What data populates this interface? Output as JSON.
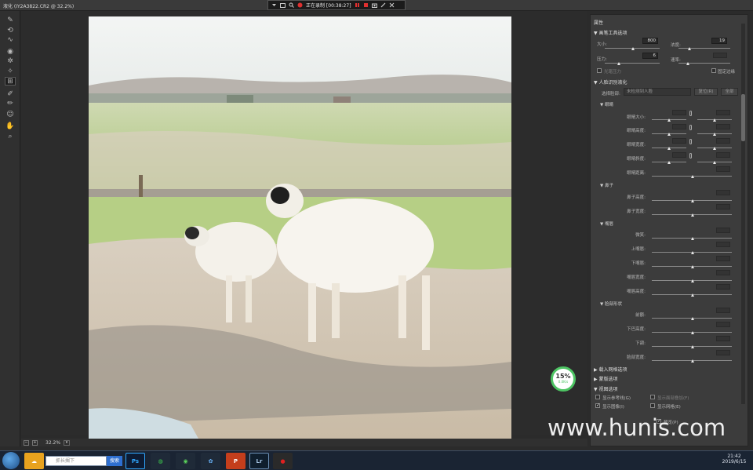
{
  "window": {
    "title": "液化 (IY2A3822.CR2 @ 32.2%)"
  },
  "recorder": {
    "status": "正在录制 [00:38:27]"
  },
  "statusbar": {
    "zoom": "32.2%"
  },
  "panel": {
    "title": "属性",
    "brush": {
      "header": "画笔工具选项",
      "size_label": "大小:",
      "size_value": "800",
      "density_label": "浓度:",
      "density_value": "19",
      "pressure_label": "压力:",
      "pressure_value": "6",
      "rate_label": "速率:",
      "stylus_label": "光笔压力",
      "pin_edges_label": "固定边缘"
    },
    "face": {
      "header": "人脸识别液化",
      "select_face_label": "选择脸部:",
      "select_face_value": "未检测到人脸",
      "reset_label": "复位(R)",
      "all_label": "全部",
      "eyes_header": "眼睛",
      "eyes": [
        "眼睛大小:",
        "眼睛高度:",
        "眼睛宽度:",
        "眼睛斜度:",
        "眼睛距离:"
      ],
      "nose_header": "鼻子",
      "nose": [
        "鼻子高度:",
        "鼻子宽度:"
      ],
      "mouth_header": "嘴唇",
      "mouth": [
        "微笑:",
        "上嘴唇:",
        "下嘴唇:",
        "嘴唇宽度:",
        "嘴唇高度:"
      ],
      "face_header": "脸部形状",
      "face_shape": [
        "前额:",
        "下巴高度:",
        "下颌:",
        "脸部宽度:"
      ]
    },
    "load_mesh": "载入网格选项",
    "mask": "蒙版选项",
    "view": {
      "header": "视图选项",
      "show_guides": "显示参考线(G)",
      "show_face_overlay": "显示面部叠加(F)",
      "show_image": "显示图像(I)",
      "show_mesh": "显示网格(E)",
      "preview": "预览(P)"
    }
  },
  "progress": {
    "value": "15%",
    "sub": "0.0K/s"
  },
  "taskbar": {
    "search_placeholder": "抓长搁下",
    "search_btn": "搜索",
    "time": "21:42",
    "date": "2019/6/15"
  },
  "watermark": "www.hunis.com",
  "colors": {
    "accent": "#4dc463",
    "panel": "#3c3c3c",
    "canvas": "#2c2c2c"
  }
}
